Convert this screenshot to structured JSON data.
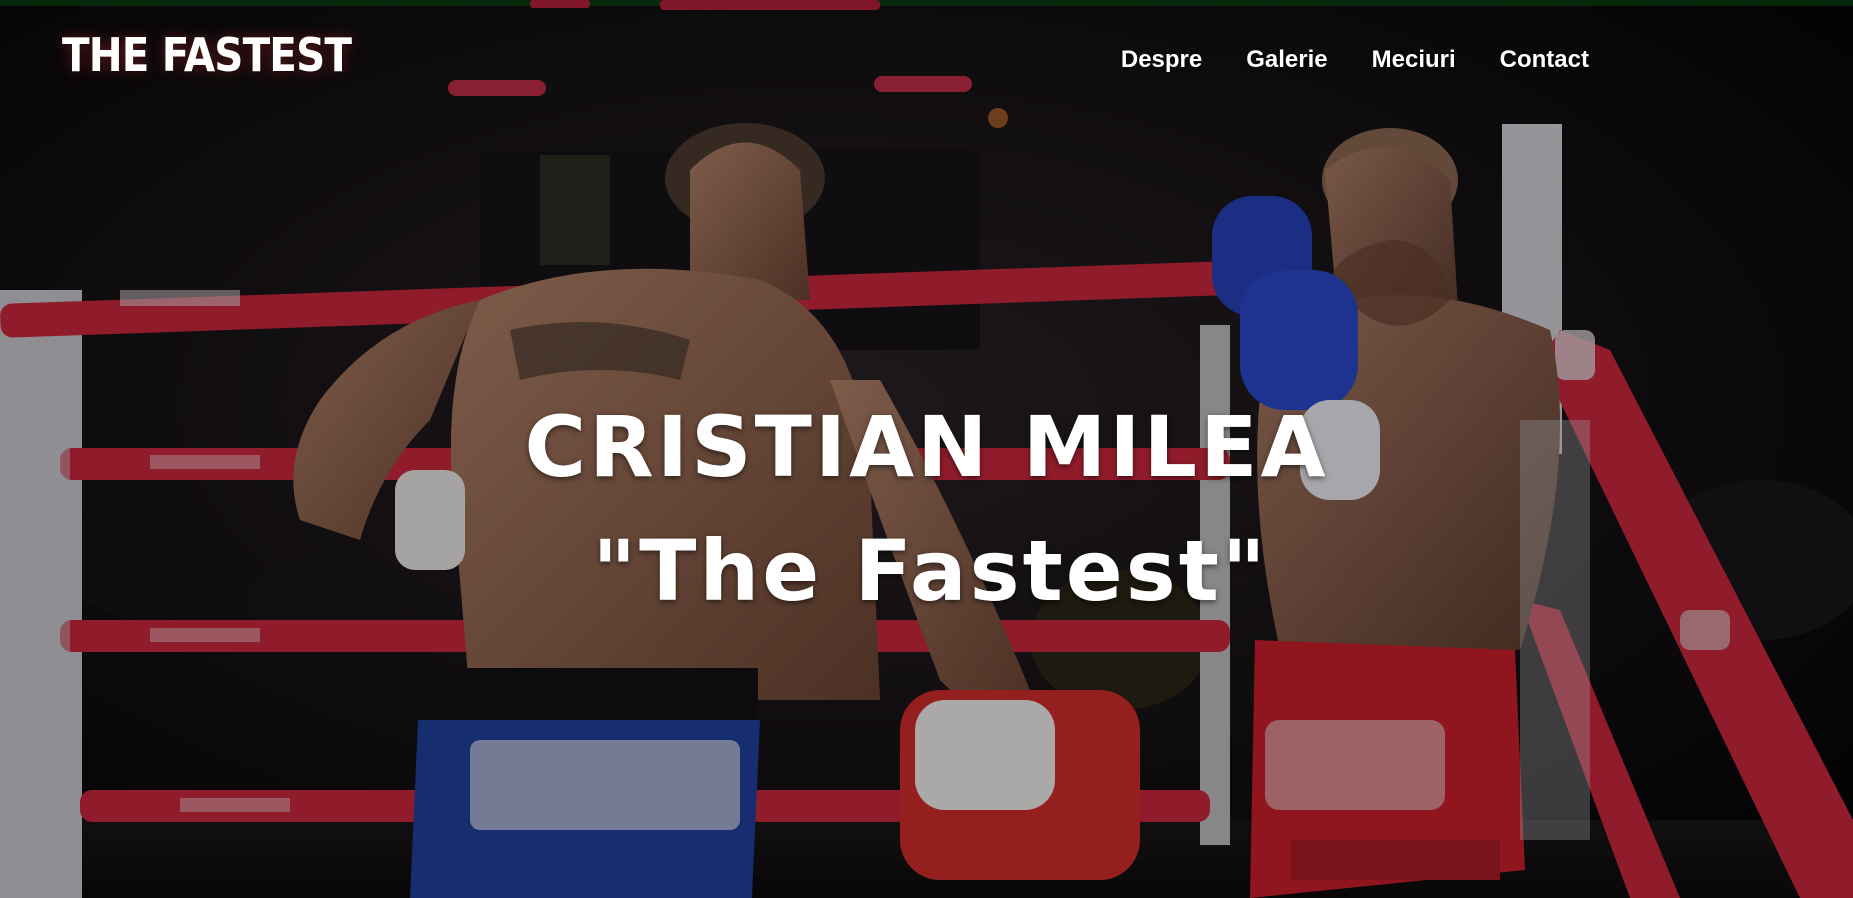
{
  "brand": {
    "logo_text": "THE FASTEST"
  },
  "nav": {
    "items": [
      {
        "label": "Despre"
      },
      {
        "label": "Galerie"
      },
      {
        "label": "Meciuri"
      },
      {
        "label": "Contact"
      }
    ]
  },
  "hero": {
    "title_line1": "CRISTIAN MILEA",
    "title_line2": "\"The Fastest\"",
    "background": "boxing-ring-fight-photo"
  },
  "colors": {
    "text": "#ffffff",
    "rope_red": "#c8283c",
    "shorts_blue": "#1f3f9a",
    "shorts_red": "#c81e2a"
  }
}
